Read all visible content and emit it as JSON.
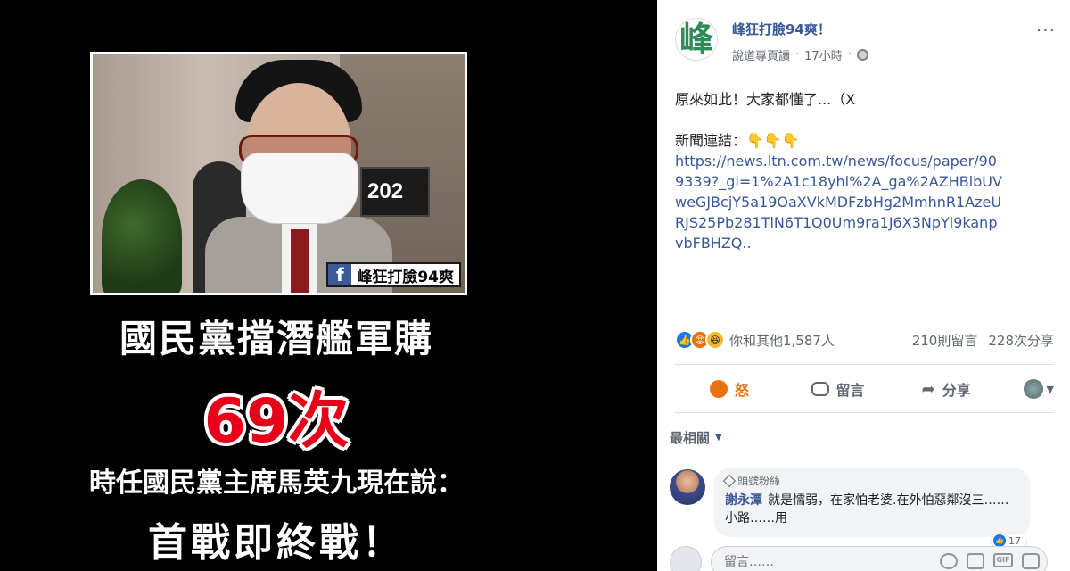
{
  "media": {
    "room_plaque": "202",
    "watermark_fb": "f",
    "watermark_text": "峰狂打臉94爽",
    "headline_1": "國民黨擋潛艦軍購",
    "headline_2": "69次",
    "headline_3": "時任國民黨主席馬英九現在說：",
    "headline_4": "首戰即終戰！"
  },
  "post": {
    "avatar_char": "峰",
    "page_name": "峰狂打臉94爽！",
    "byline": "說道專頁讀",
    "time": "17小時",
    "more": "···",
    "text": "原來如此！大家都懂了...（X",
    "news_label": "新聞連結：👇👇👇",
    "news_link": "https://news.ltn.com.tw/news/focus/paper/909339?_gl=1%2A1c18yhi%2A_ga%2AZHBlbUVweGJBcjY5a19OaXVkMDFzbHg2MmhnR1AzeURJS25Pb281TlN6T1Q0Um9ra1J6X3NpYl9kanpvbFBHZQ..",
    "reactions": {
      "summary": "你和其他1,587人",
      "comments": "210則留言",
      "shares": "228次分享"
    },
    "actions": {
      "react": "怒",
      "comment": "留言",
      "share": "分享"
    },
    "sort_label": "最相關",
    "comment": {
      "badge": "頭號粉絲",
      "author": "謝永潭",
      "text": "就是懦弱，在家怕老婆.在外怕惡鄰沒三……小路……用",
      "reaction_count": "17"
    },
    "composer_placeholder": "留言……"
  },
  "colors": {
    "facebook_blue": "#385898",
    "angry_orange": "#e9710f",
    "headline_red": "#e6001a"
  }
}
